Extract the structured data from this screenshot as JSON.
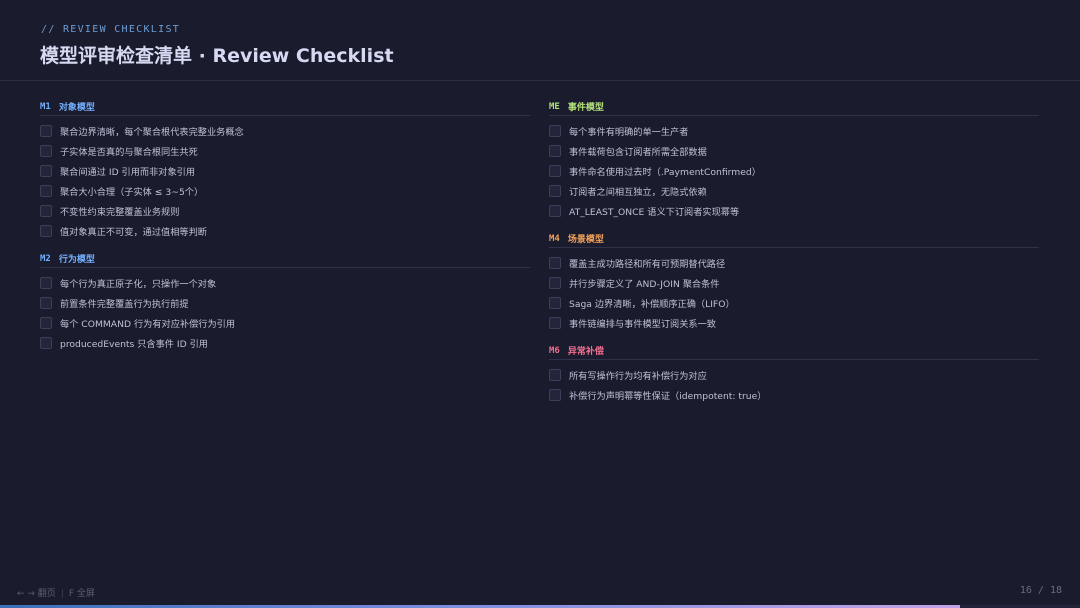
{
  "header": {
    "eyebrow": "// REVIEW CHECKLIST",
    "title": "模型评审检查清单 · Review Checklist"
  },
  "colors": {
    "m1": "#72aefc",
    "m2": "#72aefc",
    "me": "#b3e07a",
    "m4": "#f0a05b",
    "m6": "#f06f8f"
  },
  "left_sections": [
    {
      "code": "M1",
      "name": "对象模型",
      "color_key": "m1",
      "items": [
        "聚合边界清晰，每个聚合根代表完整业务概念",
        "子实体是否真的与聚合根同生共死",
        "聚合间通过 ID 引用而非对象引用",
        "聚合大小合理（子实体 ≤ 3~5个）",
        "不变性约束完整覆盖业务规则",
        "值对象真正不可变，通过值相等判断"
      ]
    },
    {
      "code": "M2",
      "name": "行为模型",
      "color_key": "m2",
      "items": [
        "每个行为真正原子化，只操作一个对象",
        "前置条件完整覆盖行为执行前提",
        "每个 COMMAND 行为有对应补偿行为引用",
        "producedEvents 只含事件 ID 引用"
      ]
    }
  ],
  "right_sections": [
    {
      "code": "ME",
      "name": "事件模型",
      "color_key": "me",
      "items": [
        "每个事件有明确的单一生产者",
        "事件载荷包含订阅者所需全部数据",
        "事件命名使用过去时（.PaymentConfirmed）",
        "订阅者之间相互独立，无隐式依赖",
        "AT_LEAST_ONCE 语义下订阅者实现幂等"
      ]
    },
    {
      "code": "M4",
      "name": "场景模型",
      "color_key": "m4",
      "items": [
        "覆盖主成功路径和所有可预期替代路径",
        "并行步骤定义了 AND-JOIN 聚合条件",
        "Saga 边界清晰，补偿顺序正确（LIFO）",
        "事件链编排与事件模型订阅关系一致"
      ]
    },
    {
      "code": "M6",
      "name": "异常补偿",
      "color_key": "m6",
      "items": [
        "所有写操作行为均有补偿行为对应",
        "补偿行为声明幂等性保证（idempotent: true）"
      ]
    }
  ],
  "footer": {
    "nav_hint": "← → 翻页",
    "fullscreen_hint": "F 全屏",
    "page_label": "16 / 18",
    "progress": 0.889
  }
}
